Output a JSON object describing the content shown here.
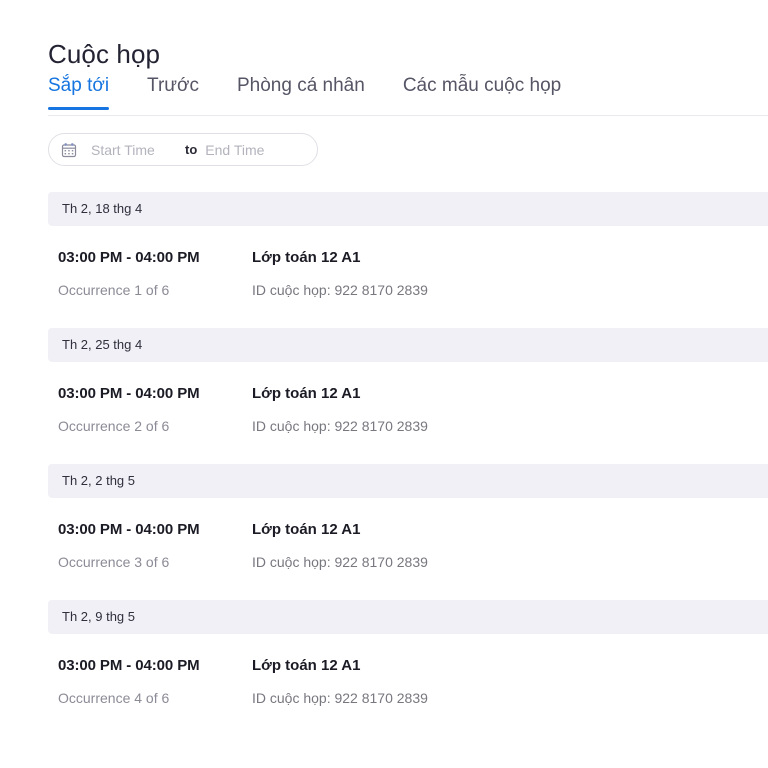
{
  "header": {
    "title": "Cuộc họp"
  },
  "tabs": [
    {
      "label": "Sắp tới",
      "active": true
    },
    {
      "label": "Trước",
      "active": false
    },
    {
      "label": "Phòng cá nhân",
      "active": false
    },
    {
      "label": "Các mẫu cuộc họp",
      "active": false
    }
  ],
  "filter": {
    "calendar_icon": "calendar-icon",
    "start_placeholder": "Start Time",
    "start_value": "",
    "separator": "to",
    "end_placeholder": "End Time",
    "end_value": ""
  },
  "colors": {
    "accent": "#1675e0",
    "group_band": "#f1f0f6",
    "text_primary": "#1b1b25",
    "text_muted": "#8b8b97"
  },
  "groups": [
    {
      "date": "Th 2, 18 thg 4",
      "meetings": [
        {
          "time": "03:00 PM - 04:00 PM",
          "occurrence": "Occurrence 1 of 6",
          "title": "Lớp toán 12 A1",
          "meeting_id": "ID cuộc họp: 922 8170 2839"
        }
      ]
    },
    {
      "date": "Th 2, 25 thg 4",
      "meetings": [
        {
          "time": "03:00 PM - 04:00 PM",
          "occurrence": "Occurrence 2 of 6",
          "title": "Lớp toán 12 A1",
          "meeting_id": "ID cuộc họp: 922 8170 2839"
        }
      ]
    },
    {
      "date": "Th 2, 2 thg 5",
      "meetings": [
        {
          "time": "03:00 PM - 04:00 PM",
          "occurrence": "Occurrence 3 of 6",
          "title": "Lớp toán 12 A1",
          "meeting_id": "ID cuộc họp: 922 8170 2839"
        }
      ]
    },
    {
      "date": "Th 2, 9 thg 5",
      "meetings": [
        {
          "time": "03:00 PM - 04:00 PM",
          "occurrence": "Occurrence 4 of 6",
          "title": "Lớp toán 12 A1",
          "meeting_id": "ID cuộc họp: 922 8170 2839"
        }
      ]
    }
  ]
}
